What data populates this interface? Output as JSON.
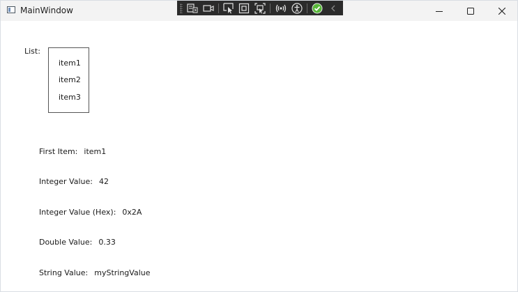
{
  "window": {
    "title": "MainWindow"
  },
  "list": {
    "label": "List:",
    "items": [
      "item1",
      "item2",
      "item3"
    ]
  },
  "fields": {
    "first_item": {
      "label": "First Item:",
      "value": "item1"
    },
    "integer": {
      "label": "Integer Value:",
      "value": "42"
    },
    "integer_hex": {
      "label": "Integer Value (Hex):",
      "value": "0x2A"
    },
    "double": {
      "label": "Double Value:",
      "value": "0.33"
    },
    "string": {
      "label": "String Value:",
      "value": "myStringValue"
    }
  },
  "debug_toolbar": {
    "icons": [
      "live-visual-tree-icon",
      "record-icon",
      "select-element-icon",
      "display-layout-adorners-icon",
      "track-focus-icon",
      "binding-failures-icon",
      "accessibility-icon",
      "success-check-icon",
      "collapse-chevron-icon"
    ],
    "colors": {
      "background": "#2b2b2b",
      "success": "#59b83a"
    }
  }
}
